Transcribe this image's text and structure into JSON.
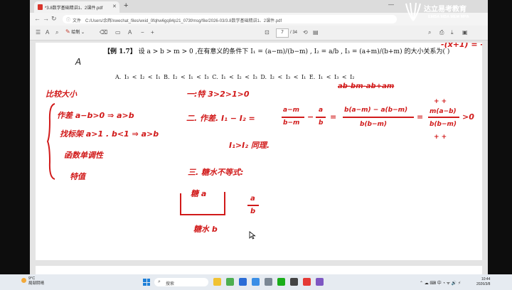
{
  "browser": {
    "tab_title": "*3.8数学基础精讲1、2课件.pdf",
    "tab_close": "✕",
    "new_tab": "+",
    "address_label": "文件",
    "address_path": "C:/Users/余辉/xwechat_files/wxid_0fqhw6gq84p21_073f/msg/file/2026-03/3.8数学基础精讲1、2课件.pdf"
  },
  "pdf_toolbar": {
    "draw_label": "绘制",
    "page_current": "7",
    "page_total": "/ 34"
  },
  "logo": {
    "title": "达立易考教育",
    "subtitle": "EMBA MBA MEM MPA"
  },
  "question": {
    "label": "【例 1.7】",
    "stem": "设 a > b > m > 0 ,在有意义的条件下 I₁ = (a−m)/(b−m) , I₂ = a/b , I₃ = (a+m)/(b+m) 的大小关系为(    )",
    "options": "A. I₃ < I₂ < I₁    B. I₂ < I₁ < I₃    C. I₁ < I₂ < I₃    D. I₂ < I₃ < I₁    E. I₁ < I₃ < I₂"
  },
  "handwriting": {
    "answer_letter": "A",
    "top_right": "-(x+1) = -x-1",
    "heading": "比较大小",
    "m1": "作差 a−b>0 ⇒ a>b",
    "m2": "找标架 a>1 . b<1 ⇒ a>b",
    "m3": "函数单调性",
    "m4": "特值",
    "step1": "一:特 3>2>1>0",
    "step2_a": "二. 作差. I₁ − I₂ =",
    "step2_b": "a−m",
    "step2_c": "b−m",
    "step2_d": "a",
    "step2_e": "b",
    "step2_f": "b(a−m) − a(b−m)",
    "step2_g": "b(b−m)",
    "step2_h": "m(a−b)",
    "step2_i": "b(b−m)",
    "step2_j": ">0",
    "crossed": "ab-bm-ab+am",
    "signs_top": "+    +",
    "signs_bottom": "+    +",
    "conclusion": "I₁>I₂  同理.",
    "step3": "三. 糖水不等式:",
    "box_top": "糖 a",
    "box_bottom": "糖水 b",
    "frac_top": "a",
    "frac_bottom": "b"
  },
  "taskbar": {
    "weather_temp": "9°C",
    "weather_desc": "局部阴晴",
    "search_placeholder": "搜索",
    "time": "10:44",
    "date": "2026/3/8"
  }
}
